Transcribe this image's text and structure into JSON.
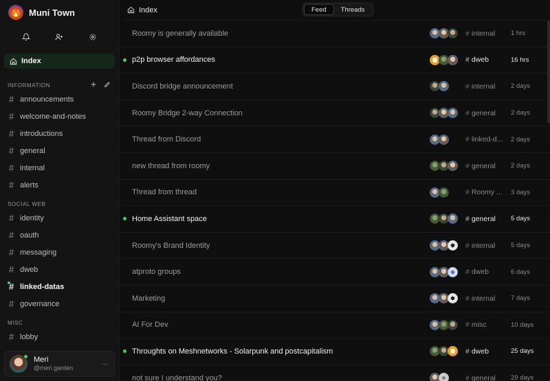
{
  "space": {
    "name": "Muni Town"
  },
  "sidebar": {
    "index_label": "Index",
    "sections": [
      {
        "title": "INFORMATION",
        "channels": [
          "announcements",
          "welcome-and-notes",
          "introductions",
          "general",
          "internal",
          "alerts"
        ]
      },
      {
        "title": "SOCIAL WEB",
        "channels": [
          "identity",
          "oauth",
          "messaging",
          "dweb",
          "linked-datas",
          "governance"
        ]
      },
      {
        "title": "MISC",
        "channels": [
          "lobby"
        ]
      }
    ],
    "active_channel": "linked-datas",
    "user": {
      "name": "Meri",
      "handle": "@meri.garden",
      "more": "···"
    }
  },
  "topbar": {
    "breadcrumb": "Index",
    "tabs": [
      "Feed",
      "Threads"
    ],
    "active_tab": "Feed"
  },
  "threads": [
    {
      "title": "Roomy is generally available",
      "channel": "internal",
      "time": "1 hrs",
      "unread": false,
      "avatars": [
        "a1",
        "a3",
        "a2"
      ]
    },
    {
      "title": "p2p browser affordances",
      "channel": "dweb",
      "time": "16 hrs",
      "unread": true,
      "avatars": [
        "a4",
        "a5",
        "a3"
      ]
    },
    {
      "title": "Discord bridge announcement",
      "channel": "internal",
      "time": "2 days",
      "unread": false,
      "avatars": [
        "a2",
        "a1"
      ]
    },
    {
      "title": "Roomy Bridge 2-way Connection",
      "channel": "general",
      "time": "2 days",
      "unread": false,
      "avatars": [
        "a2",
        "a3",
        "a1"
      ]
    },
    {
      "title": "Thread from Discord",
      "channel": "linked-d...",
      "time": "2 days",
      "unread": false,
      "avatars": [
        "a1",
        "a3"
      ]
    },
    {
      "title": "new thread from roomy",
      "channel": "general",
      "time": "2 days",
      "unread": false,
      "avatars": [
        "a5",
        "a2",
        "a3"
      ]
    },
    {
      "title": "Thread from thread",
      "channel": "Roomy ...",
      "time": "3 days",
      "unread": false,
      "avatars": [
        "a1",
        "a5"
      ]
    },
    {
      "title": "Home Assistant space",
      "channel": "general",
      "time": "5 days",
      "unread": true,
      "avatars": [
        "a5",
        "a2",
        "a1"
      ]
    },
    {
      "title": "Roomy's Brand Identity",
      "channel": "internal",
      "time": "5 days",
      "unread": false,
      "avatars": [
        "a1",
        "a3",
        "a6"
      ]
    },
    {
      "title": "atproto groups",
      "channel": "dweb",
      "time": "6 days",
      "unread": false,
      "avatars": [
        "a1",
        "a3",
        "a7"
      ]
    },
    {
      "title": "Marketing",
      "channel": "internal",
      "time": "7 days",
      "unread": false,
      "avatars": [
        "a1",
        "a3",
        "a6"
      ]
    },
    {
      "title": "AI For Dev",
      "channel": "misc",
      "time": "10 days",
      "unread": false,
      "avatars": [
        "a1",
        "a5",
        "a2"
      ]
    },
    {
      "title": "Throughts on Meshnetworks - Solarpunk and postcapitalism",
      "channel": "dweb",
      "time": "25 days",
      "unread": true,
      "avatars": [
        "a5",
        "a2",
        "a4"
      ]
    },
    {
      "title": "not sure I understand you?",
      "channel": "general",
      "time": "29 days",
      "unread": false,
      "avatars": [
        "a3",
        "a8"
      ]
    }
  ]
}
